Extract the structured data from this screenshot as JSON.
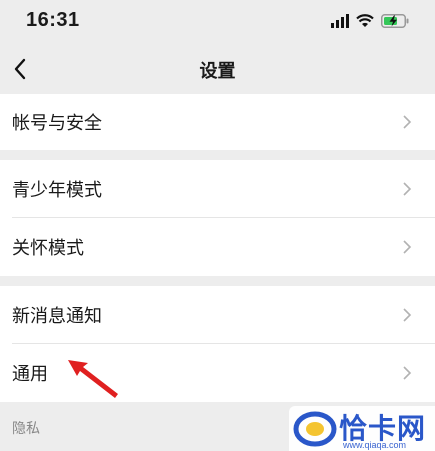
{
  "status_bar": {
    "time": "16:31",
    "icons": [
      "signal-icon",
      "wifi-icon",
      "battery-charging-icon"
    ]
  },
  "nav": {
    "title": "设置",
    "back_icon": "chevron-left-icon"
  },
  "groups": [
    {
      "items": [
        {
          "label": "帐号与安全"
        }
      ]
    },
    {
      "items": [
        {
          "label": "青少年模式"
        },
        {
          "label": "关怀模式"
        }
      ]
    },
    {
      "items": [
        {
          "label": "新消息通知"
        },
        {
          "label": "通用"
        }
      ]
    }
  ],
  "section_label": "隐私",
  "annotation": {
    "color": "#e02020",
    "target": "通用"
  },
  "watermark": {
    "text": "恰卡网",
    "sub": "www.qiaqa.com",
    "color": "#2a57c9"
  },
  "colors": {
    "background": "#ededed",
    "card": "#ffffff",
    "chevron": "#b2b2b2"
  }
}
